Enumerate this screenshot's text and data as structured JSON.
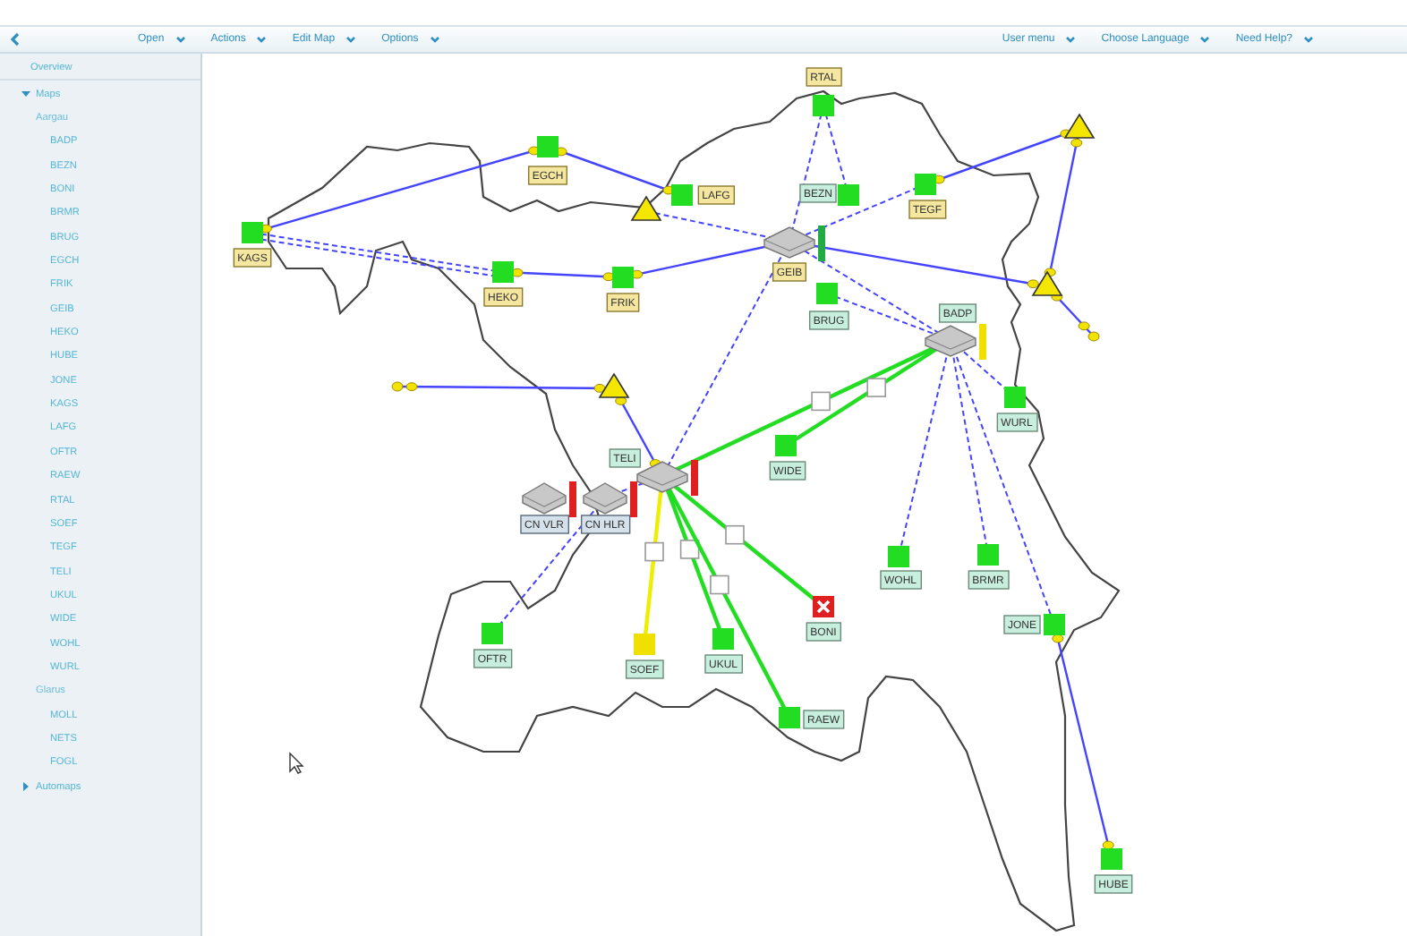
{
  "toolbar": {
    "left_menus": [
      "Open",
      "Actions",
      "Edit Map",
      "Options"
    ],
    "right_menus": [
      "User menu",
      "Choose Language",
      "Need Help?"
    ]
  },
  "sidebar": {
    "items": [
      {
        "label": "Overview",
        "kind": "link"
      },
      {
        "label": "Maps",
        "kind": "folder",
        "expanded": true,
        "children": [
          {
            "label": "Aargau",
            "kind": "group",
            "children": [
              {
                "label": "BADP"
              },
              {
                "label": "BEZN"
              },
              {
                "label": "BONI"
              },
              {
                "label": "BRMR"
              },
              {
                "label": "BRUG"
              },
              {
                "label": "EGCH"
              },
              {
                "label": "FRIK"
              },
              {
                "label": "GEIB"
              },
              {
                "label": "HEKO"
              },
              {
                "label": "HUBE"
              },
              {
                "label": "JONE"
              },
              {
                "label": "KAGS"
              },
              {
                "label": "LAFG"
              },
              {
                "label": "OFTR"
              },
              {
                "label": "RAEW"
              },
              {
                "label": "RTAL"
              },
              {
                "label": "SOEF"
              },
              {
                "label": "TEGF"
              },
              {
                "label": "TELI"
              },
              {
                "label": "UKUL"
              },
              {
                "label": "WIDE"
              },
              {
                "label": "WOHL"
              },
              {
                "label": "WURL"
              }
            ]
          },
          {
            "label": "Glarus",
            "kind": "group",
            "children": [
              {
                "label": "MOLL"
              },
              {
                "label": "NETS"
              },
              {
                "label": "FOGL"
              }
            ]
          }
        ]
      },
      {
        "label": "Automaps",
        "kind": "folder",
        "expanded": false
      }
    ]
  },
  "map": {
    "nodes": [
      {
        "label": "RTAL",
        "kind": "site",
        "color": "#22dd22",
        "failed": false,
        "highlighted": true
      },
      {
        "label": "BEZN",
        "kind": "site",
        "color": "#22dd22",
        "failed": false,
        "highlighted": false
      },
      {
        "label": "TEGF",
        "kind": "site",
        "color": "#22dd22",
        "failed": false,
        "highlighted": true
      },
      {
        "label": "GEIB",
        "kind": "router",
        "color": "#22aa44",
        "highlighted": true
      },
      {
        "label": "BRUG",
        "kind": "site",
        "color": "#22dd22",
        "failed": false,
        "highlighted": false
      },
      {
        "label": "BADP",
        "kind": "router",
        "color": "#f0e000",
        "highlighted": false
      },
      {
        "label": "WURL",
        "kind": "site",
        "color": "#22dd22",
        "failed": false,
        "highlighted": false
      },
      {
        "label": "WIDE",
        "kind": "site",
        "color": "#22dd22",
        "failed": false,
        "highlighted": false
      },
      {
        "label": "TELI",
        "kind": "router",
        "color": "#e02020",
        "highlighted": false
      },
      {
        "label": "CN VLR",
        "kind": "server",
        "color": "#e02020",
        "highlighted": false
      },
      {
        "label": "CN HLR",
        "kind": "server",
        "color": "#e02020",
        "highlighted": false
      },
      {
        "label": "OFTR",
        "kind": "site",
        "color": "#22dd22",
        "failed": false,
        "highlighted": false
      },
      {
        "label": "SOEF",
        "kind": "site",
        "color": "#f0e000",
        "failed": false,
        "highlighted": false
      },
      {
        "label": "UKUL",
        "kind": "site",
        "color": "#22dd22",
        "failed": false,
        "highlighted": false
      },
      {
        "label": "BONI",
        "kind": "site",
        "color": "#e02020",
        "failed": true,
        "highlighted": false
      },
      {
        "label": "RAEW",
        "kind": "site",
        "color": "#22dd22",
        "failed": false,
        "highlighted": false
      },
      {
        "label": "WOHL",
        "kind": "site",
        "color": "#22dd22",
        "failed": false,
        "highlighted": false
      },
      {
        "label": "BRMR",
        "kind": "site",
        "color": "#22dd22",
        "failed": false,
        "highlighted": false
      },
      {
        "label": "JONE",
        "kind": "site",
        "color": "#22dd22",
        "failed": false,
        "highlighted": false
      },
      {
        "label": "HUBE",
        "kind": "site",
        "color": "#22dd22",
        "failed": false,
        "highlighted": false
      },
      {
        "label": "KAGS",
        "kind": "site",
        "color": "#22dd22",
        "failed": false,
        "highlighted": true
      },
      {
        "label": "EGCH",
        "kind": "site",
        "color": "#22dd22",
        "failed": false,
        "highlighted": true
      },
      {
        "label": "LAFG",
        "kind": "site",
        "color": "#22dd22",
        "failed": false,
        "highlighted": true
      },
      {
        "label": "HEKO",
        "kind": "site",
        "color": "#22dd22",
        "failed": false,
        "highlighted": true
      },
      {
        "label": "FRIK",
        "kind": "site",
        "color": "#22dd22",
        "failed": false,
        "highlighted": true
      },
      {
        "kind": "triangle"
      },
      {
        "kind": "triangle"
      },
      {
        "kind": "triangle"
      },
      {
        "kind": "triangle"
      },
      {
        "kind": "endpoint"
      },
      {
        "kind": "endpoint"
      }
    ],
    "links": [
      {
        "kind": "radio",
        "color": "#4444ff"
      },
      {
        "kind": "radio",
        "color": "#4444ff"
      },
      {
        "kind": "radio",
        "color": "#4444ff"
      },
      {
        "kind": "radio",
        "color": "#4444ff"
      },
      {
        "kind": "radio",
        "color": "#4444ff"
      },
      {
        "kind": "radio",
        "color": "#4444ff"
      },
      {
        "kind": "radio",
        "color": "#4444ff"
      },
      {
        "kind": "radio",
        "color": "#4444ff"
      },
      {
        "kind": "radio",
        "color": "#4444ff"
      },
      {
        "kind": "radio",
        "color": "#4444ff"
      },
      {
        "kind": "radio",
        "color": "#4444ff"
      },
      {
        "kind": "dashed",
        "color": "#4444ff"
      },
      {
        "kind": "dashed",
        "color": "#4444ff"
      },
      {
        "kind": "dashed",
        "color": "#4444ff"
      },
      {
        "kind": "dashed",
        "color": "#4444ff"
      },
      {
        "kind": "dashed",
        "color": "#4444ff"
      },
      {
        "kind": "dashed",
        "color": "#4444ff"
      },
      {
        "kind": "dashed",
        "color": "#4444ff"
      },
      {
        "kind": "dashed",
        "color": "#4444ff"
      },
      {
        "kind": "dashed",
        "color": "#4444ff"
      },
      {
        "kind": "dashed",
        "color": "#4444ff"
      },
      {
        "kind": "dashed",
        "color": "#4444ff"
      },
      {
        "kind": "dashed",
        "color": "#4444ff"
      },
      {
        "kind": "dashed",
        "color": "#4444ff"
      },
      {
        "kind": "dashed",
        "color": "#4444ff"
      },
      {
        "kind": "dashed",
        "color": "#4444ff"
      },
      {
        "kind": "fiber",
        "color": "#22dd22"
      },
      {
        "kind": "fiber",
        "color": "#22dd22"
      },
      {
        "kind": "fiber",
        "color": "#eeee00"
      },
      {
        "kind": "fiber",
        "color": "#22dd22"
      },
      {
        "kind": "fiber",
        "color": "#22dd22"
      },
      {
        "kind": "fiber",
        "color": "#22dd22"
      }
    ]
  }
}
